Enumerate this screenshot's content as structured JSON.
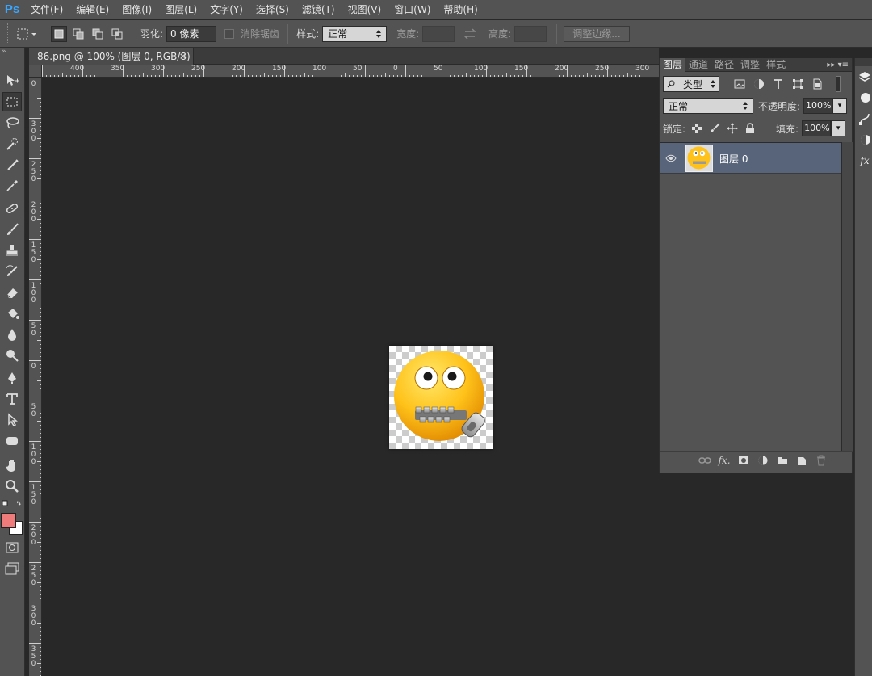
{
  "app": {
    "logo": "Ps",
    "accent": "#31a8ff"
  },
  "menu": [
    "文件(F)",
    "编辑(E)",
    "图像(I)",
    "图层(L)",
    "文字(Y)",
    "选择(S)",
    "滤镜(T)",
    "视图(V)",
    "窗口(W)",
    "帮助(H)"
  ],
  "options": {
    "feather_label": "羽化:",
    "feather_value": "0 像素",
    "antialias_label": "消除锯齿",
    "style_label": "样式:",
    "style_value": "正常",
    "width_label": "宽度:",
    "height_label": "高度:",
    "refine_edge": "调整边缘..."
  },
  "document": {
    "tab_title": "86.png @ 100% (图层 0, RGB/8)",
    "close": "×"
  },
  "ruler": {
    "h_labels": [
      "400",
      "350",
      "300",
      "250",
      "200",
      "150",
      "100",
      "50",
      "0",
      "50",
      "100",
      "150",
      "200",
      "250",
      "300"
    ],
    "v_labels": [
      "0",
      "3|0|0",
      "2|5|0",
      "2|0|0",
      "1|5|0",
      "1|0|0",
      "5|0",
      "0",
      "5|0",
      "1|0|0",
      "1|5|0",
      "2|0|0",
      "2|5|0",
      "3|0|0",
      "3|5|0",
      "4"
    ]
  },
  "tools": [
    "move-icon",
    "marquee-icon",
    "lasso-icon",
    "quick-select-icon",
    "crop-icon",
    "eyedropper-icon",
    "healing-icon",
    "brush-icon",
    "stamp-icon",
    "history-brush-icon",
    "eraser-icon",
    "paint-bucket-icon",
    "blur-icon",
    "dodge-icon",
    "pen-icon",
    "type-icon",
    "path-select-icon",
    "shape-icon",
    "hand-icon",
    "zoom-icon"
  ],
  "colors": {
    "foreground": "#f07b7b",
    "background": "#ffffff"
  },
  "layers_panel": {
    "tabs": [
      "图层",
      "通道",
      "路径",
      "调整",
      "样式"
    ],
    "kind_label": "类型",
    "blend_mode": "正常",
    "opacity_label": "不透明度:",
    "opacity_value": "100%",
    "lock_label": "锁定:",
    "fill_label": "填充:",
    "fill_value": "100%",
    "layers": [
      {
        "name": "图层 0"
      }
    ]
  }
}
